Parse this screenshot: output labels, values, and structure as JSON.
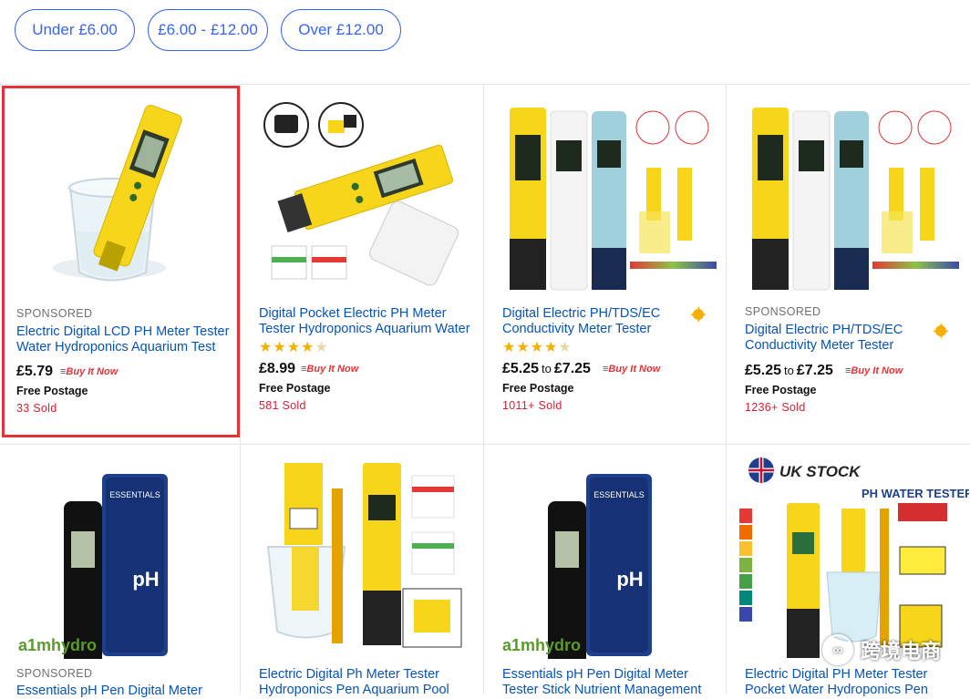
{
  "filters": [
    {
      "label": "Under £6.00"
    },
    {
      "label": "£6.00 - £12.00"
    },
    {
      "label": "Over £12.00"
    }
  ],
  "buy_it_now_text": "Buy It Now",
  "products": [
    {
      "sponsored": "SPONSORED",
      "title": "Electric Digital LCD PH Meter Tester Water Hydroponics Aquarium Test",
      "rating": null,
      "price": "£5.79",
      "price_to": "",
      "price_high": "",
      "shipping": "Free Postage",
      "sold": "33 Sold",
      "top_rated": false,
      "selected": true,
      "image": "ph-pen-in-glass"
    },
    {
      "sponsored": "",
      "title": "Digital Pocket Electric PH Meter Tester Hydroponics Aquarium Water",
      "rating": 4.5,
      "price": "£8.99",
      "price_to": "",
      "price_high": "",
      "shipping": "Free Postage",
      "sold": "581 Sold",
      "top_rated": false,
      "selected": false,
      "image": "ph-pen-kit"
    },
    {
      "sponsored": "",
      "title": "Digital Electric PH/TDS/EC Conductivity Meter Tester",
      "rating": 4.5,
      "price": "£5.25",
      "price_to": "to",
      "price_high": "£7.25",
      "shipping": "Free Postage",
      "sold": "1011+ Sold",
      "top_rated": true,
      "selected": false,
      "image": "ph-tds-set"
    },
    {
      "sponsored": "SPONSORED",
      "title": "Digital Electric PH/TDS/EC Conductivity Meter Tester",
      "rating": null,
      "price": "£5.25",
      "price_to": "to",
      "price_high": "£7.25",
      "shipping": "Free Postage",
      "sold": "1236+ Sold",
      "top_rated": true,
      "selected": false,
      "image": "ph-tds-set"
    },
    {
      "sponsored": "SPONSORED",
      "title": "Essentials pH Pen Digital Meter",
      "image": "essentials-ph-pen",
      "brand_text": "a1mhydro",
      "box_text": "ESSENTIALS"
    },
    {
      "sponsored": "",
      "title": "Electric Digital Ph Meter Tester Hydroponics Pen Aquarium Pool",
      "image": "ph-pen-and-glass"
    },
    {
      "sponsored": "",
      "title": "Essentials pH Pen Digital Meter Tester Stick Nutrient Management",
      "image": "essentials-ph-pen",
      "brand_text": "a1mhydro",
      "box_text": "ESSENTIALS"
    },
    {
      "sponsored": "",
      "title": "Electric Digital PH Meter Tester Pocket Water Hydroponics Pen",
      "image": "uk-stock-ph-tester",
      "uk_stock": "UK STOCK",
      "ph_water_tester": "PH WATER TESTER"
    }
  ],
  "watermark": "跨境电商"
}
